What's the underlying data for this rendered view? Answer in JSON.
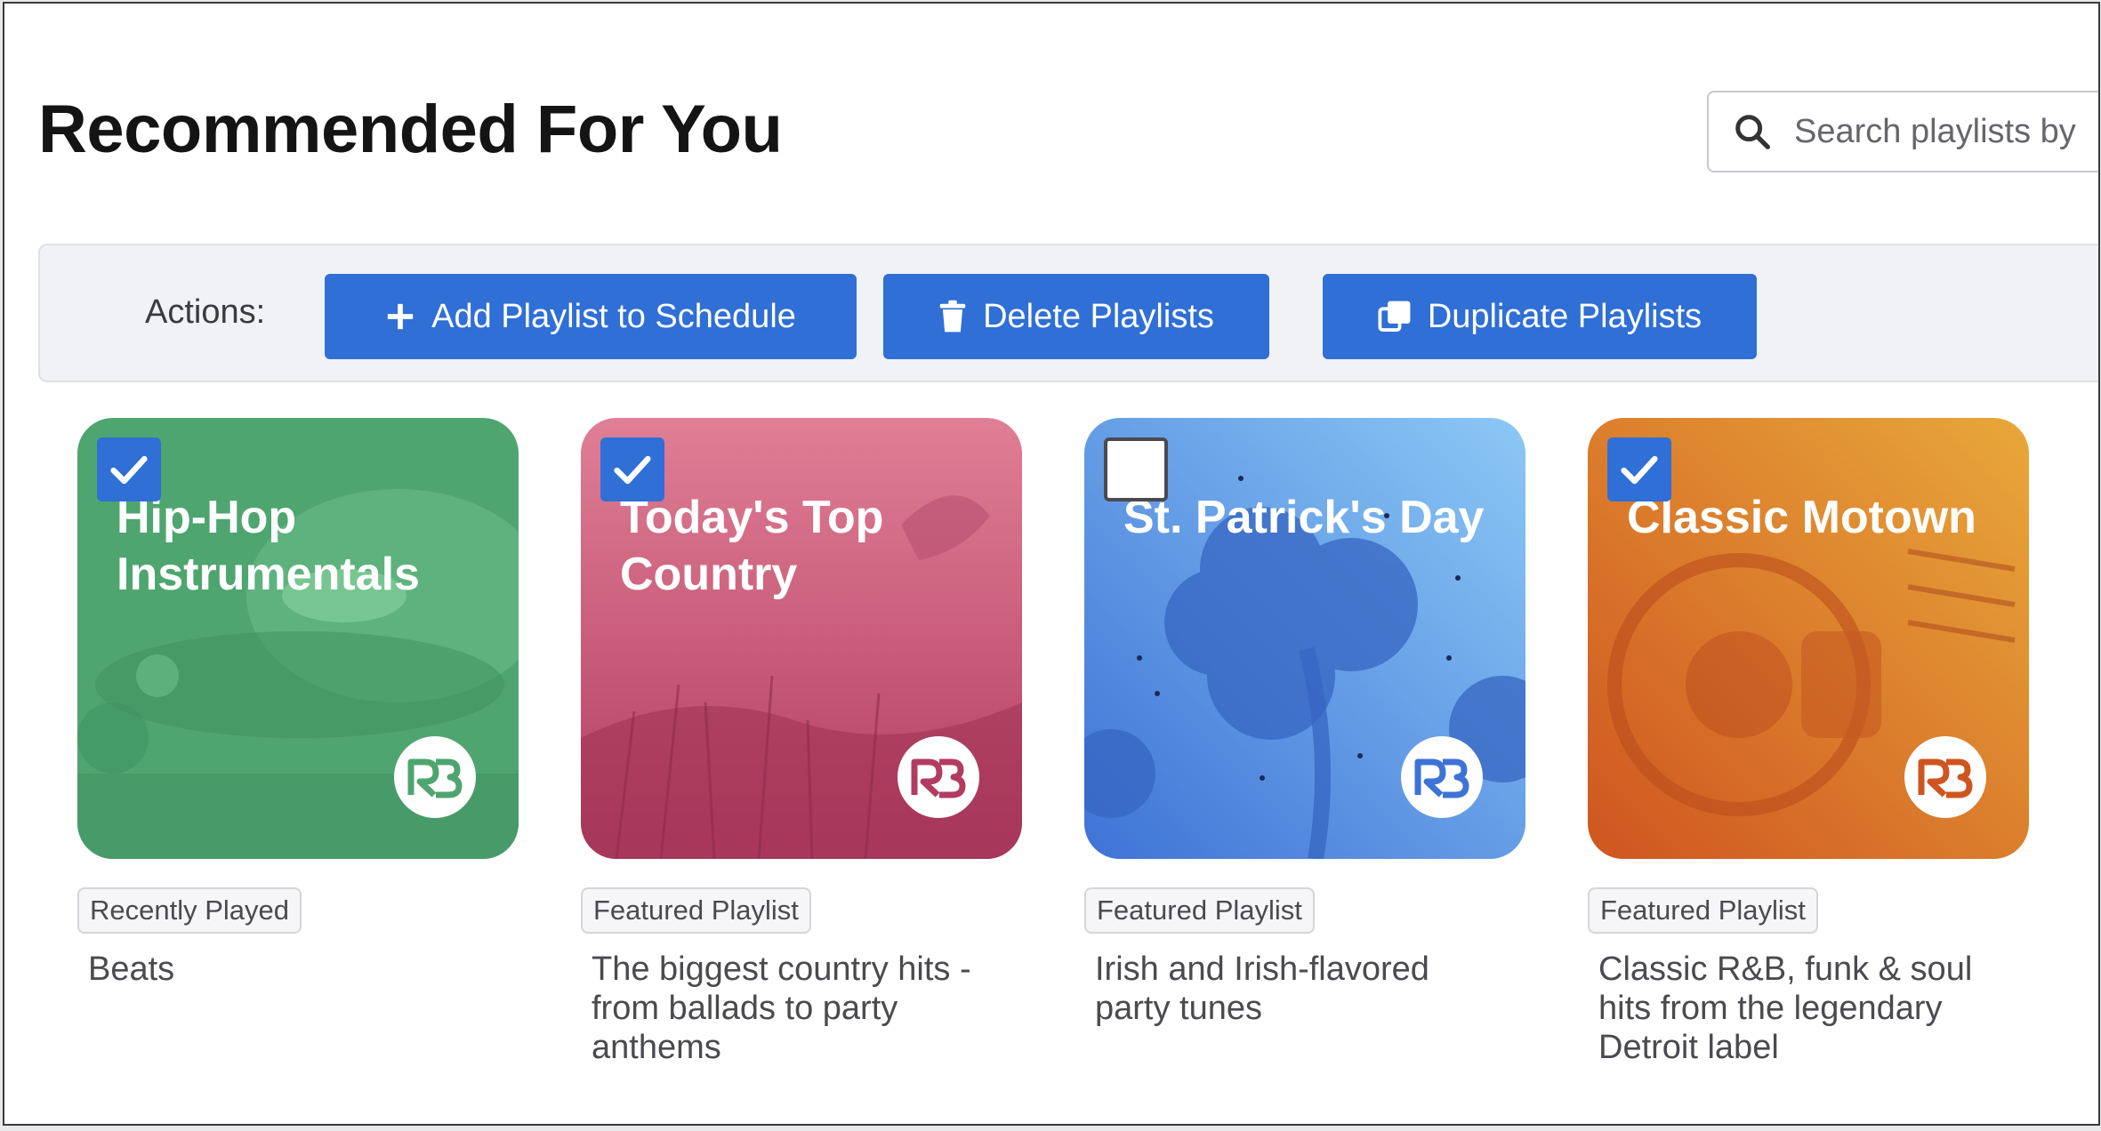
{
  "page": {
    "title": "Recommended For You"
  },
  "search": {
    "placeholder": "Search playlists by",
    "icon": "search-icon"
  },
  "actions": {
    "label": "Actions:",
    "buttons": [
      {
        "label": "Add Playlist to Schedule",
        "icon": "plus-icon"
      },
      {
        "label": "Delete Playlists",
        "icon": "trash-icon"
      },
      {
        "label": "Duplicate Playlists",
        "icon": "duplicate-icon"
      }
    ]
  },
  "colors": {
    "accent": "#2f6fd6"
  },
  "playlists": [
    {
      "title": "Hip-Hop Instrumentals",
      "checked": true,
      "badge": "Recently Played",
      "description": "Beats",
      "color": "#4fa56f"
    },
    {
      "title": "Today's Top Country",
      "checked": true,
      "badge": "Featured Playlist",
      "description": "The biggest country hits - from ballads to party anthems",
      "color": "#d1577a"
    },
    {
      "title": "St. Patrick's Day",
      "checked": false,
      "badge": "Featured Playlist",
      "description": "Irish and Irish-flavored party tunes",
      "color": "#4f8de6"
    },
    {
      "title": "Classic Motown",
      "checked": true,
      "badge": "Featured Playlist",
      "description": "Classic R&B, funk & soul hits from the legendary Detroit label",
      "color": "#e07a2a"
    }
  ]
}
